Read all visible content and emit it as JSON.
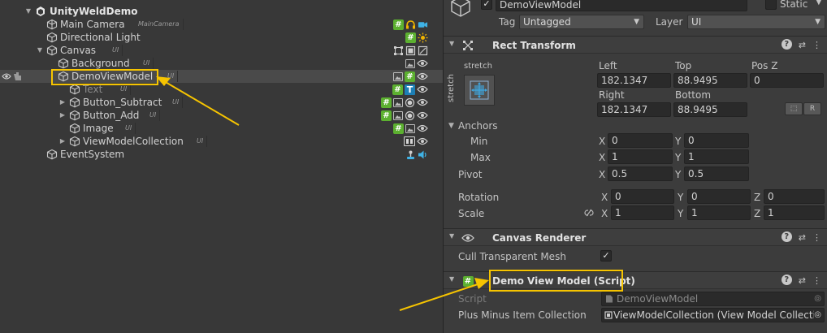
{
  "hierarchy": {
    "scene_name": "UnityWeldDemo",
    "items": [
      {
        "label": "Main Camera",
        "tag": "MainCamera"
      },
      {
        "label": "Directional Light",
        "tag": ""
      },
      {
        "label": "Canvas",
        "tag": "UI"
      },
      {
        "label": "Background",
        "tag": "UI"
      },
      {
        "label": "DemoViewModel",
        "tag": "UI"
      },
      {
        "label": "Text",
        "tag": "UI"
      },
      {
        "label": "Button_Subtract",
        "tag": "UI"
      },
      {
        "label": "Button_Add",
        "tag": "UI"
      },
      {
        "label": "Image",
        "tag": "UI"
      },
      {
        "label": "ViewModelCollection",
        "tag": "UI"
      },
      {
        "label": "EventSystem",
        "tag": ""
      }
    ],
    "icons": {
      "hash": "#",
      "text": "T"
    }
  },
  "inspector": {
    "object_name": "DemoViewModel",
    "static_label": "Static",
    "tag_label": "Tag",
    "tag_value": "Untagged",
    "layer_label": "Layer",
    "layer_value": "UI",
    "rect_transform": {
      "title": "Rect Transform",
      "anchor_preset_h": "stretch",
      "anchor_preset_v": "stretch",
      "left_label": "Left",
      "left_value": "182.1347",
      "top_label": "Top",
      "top_value": "88.9495",
      "posz_label": "Pos Z",
      "posz_value": "0",
      "right_label": "Right",
      "right_value": "182.1347",
      "bottom_label": "Bottom",
      "bottom_value": "88.9495",
      "r_button": "R",
      "anchors_label": "Anchors",
      "min_label": "Min",
      "min_x": "0",
      "min_y": "0",
      "max_label": "Max",
      "max_x": "1",
      "max_y": "1",
      "pivot_label": "Pivot",
      "pivot_x": "0.5",
      "pivot_y": "0.5",
      "rotation_label": "Rotation",
      "rot_x": "0",
      "rot_y": "0",
      "rot_z": "0",
      "scale_label": "Scale",
      "scale_x": "1",
      "scale_y": "1",
      "scale_z": "1",
      "axis_x": "X",
      "axis_y": "Y",
      "axis_z": "Z"
    },
    "canvas_renderer": {
      "title": "Canvas Renderer",
      "cull_label": "Cull Transparent Mesh",
      "cull_checked": "✓"
    },
    "script_component": {
      "title": "Demo View Model (Script)",
      "script_label": "Script",
      "script_value": "DemoViewModel",
      "collection_label": "Plus Minus Item Collection",
      "collection_value": "ViewModelCollection (View Model Collecti"
    },
    "help_icon": "?",
    "settings_icon": "⇄",
    "menu_icon": "⋮"
  },
  "colors": {
    "highlight": "#f6c400",
    "hash_green": "#5cb030",
    "text_blue": "#1d7fb5"
  }
}
